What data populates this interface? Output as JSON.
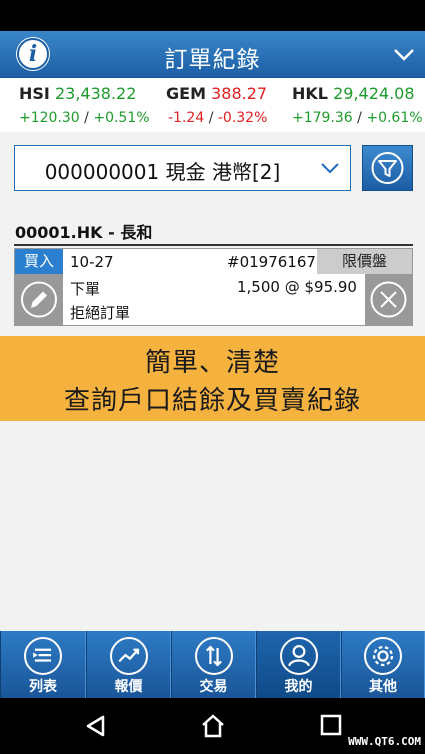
{
  "header": {
    "title": "訂單紀錄"
  },
  "indices": [
    {
      "name": "HSI",
      "value": "23,438.22",
      "change": "+120.30",
      "percent": "+0.51%",
      "direction": "up"
    },
    {
      "name": "GEM",
      "value": "388.27",
      "change": "-1.24",
      "percent": "-0.32%",
      "direction": "down"
    },
    {
      "name": "HKL",
      "value": "29,424.08",
      "change": "+179.36",
      "percent": "+0.61%",
      "direction": "up"
    }
  ],
  "account": {
    "selected": "000000001 現金 港幣[2]"
  },
  "stock": {
    "title": "00001.HK - 長和"
  },
  "order": {
    "side": "買入",
    "date": "10-27",
    "order_no": "#01976167",
    "order_type": "限價盤",
    "action": "下單",
    "qty_price": "1,500 @ $95.90",
    "status": "拒絕訂單"
  },
  "banner": {
    "line1": "簡單、清楚",
    "line2": "查詢戶口結餘及買賣紀錄"
  },
  "tabs": [
    {
      "label": "列表",
      "icon": "list-icon"
    },
    {
      "label": "報價",
      "icon": "chart-icon"
    },
    {
      "label": "交易",
      "icon": "trade-arrows-icon"
    },
    {
      "label": "我的",
      "icon": "user-icon"
    },
    {
      "label": "其他",
      "icon": "gear-icon"
    }
  ],
  "watermark": "WWW.QT6.COM",
  "colors": {
    "primary": "#1d5fa6",
    "up": "#1e9b2d",
    "down": "#e02020",
    "banner": "#f5b23f",
    "buy": "#2a7fcf"
  }
}
